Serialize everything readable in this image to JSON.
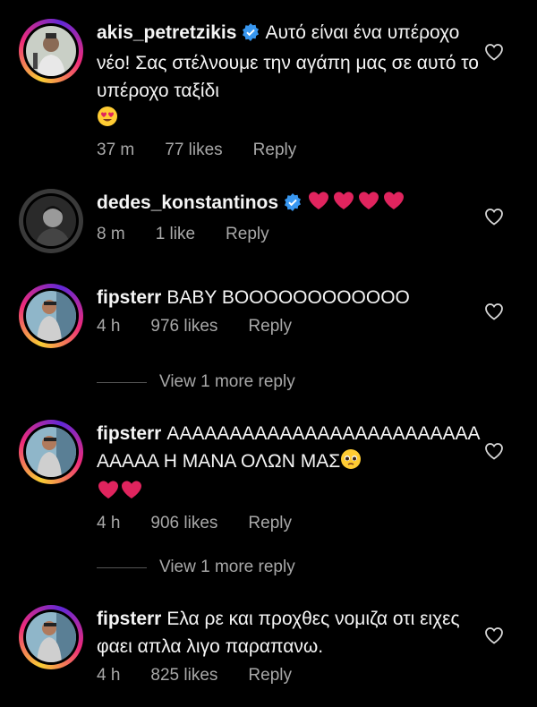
{
  "colors": {
    "background": "#000000",
    "text": "#f5f5f5",
    "meta": "#a8a8a8",
    "verified": "#3897f0",
    "heart": "#e0245e"
  },
  "comments": [
    {
      "username": "akis_petretzikis",
      "verified": true,
      "text": "Αυτό είναι ένα υπέροχο νέο! Σας στέλνουμε την αγάπη μας σε αυτό το υπέροχο ταξίδι",
      "emoji": "heart-eyes-emoji",
      "time": "37 m",
      "likes": "77 likes",
      "reply": "Reply"
    },
    {
      "username": "dedes_konstantinos",
      "verified": true,
      "text": "",
      "emoji": "red-hearts-emoji",
      "time": "8 m",
      "likes": "1 like",
      "reply": "Reply"
    },
    {
      "username": "fipsterr",
      "verified": false,
      "text": "BABY BOOOOOOOOOOOO",
      "time": "4 h",
      "likes": "976 likes",
      "reply": "Reply"
    },
    {
      "username": "fipsterr",
      "verified": false,
      "text": "AAAAAAAAAAAAAAAAAAAAAAAAAAAAAA H MANA ΟΛΩΝ ΜΑΣ",
      "emoji": "pleading-face-and-hearts-emoji",
      "time": "4 h",
      "likes": "906 likes",
      "reply": "Reply"
    },
    {
      "username": "fipsterr",
      "verified": false,
      "text": "Ελα ρε και προχθες νομιζα οτι ειχες φαει απλα λιγο παραπανω.",
      "time": "4 h",
      "likes": "825 likes",
      "reply": "Reply"
    }
  ],
  "view_more": [
    "View 1 more reply",
    "View 1 more reply"
  ]
}
